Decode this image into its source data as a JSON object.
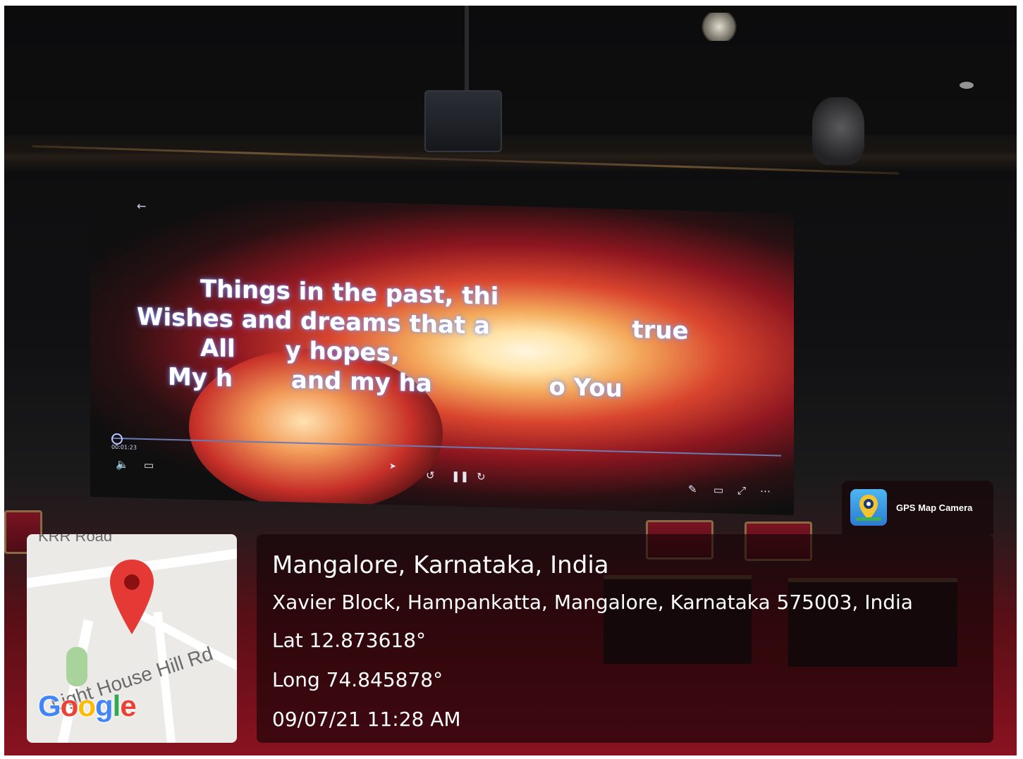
{
  "video": {
    "lyrics": [
      "Things in the past, thi",
      "Wishes and dreams that a                 true",
      "All      y hopes,",
      "My h       and my ha              o You"
    ],
    "elapsed_time": "00:01:23",
    "back_icon": "back-arrow-icon",
    "controls": [
      "volume-icon",
      "captions-icon",
      "cursor-icon",
      "rewind-icon",
      "pause-icon",
      "forward-icon",
      "pen-icon",
      "aspect-ratio-icon",
      "fullscreen-icon",
      "more-icon"
    ]
  },
  "map": {
    "top_road_label": "KRR Road",
    "bottom_road_label": "Light House Hill Rd",
    "google_logo": "Google",
    "pin_icon": "map-pin-icon"
  },
  "badge": {
    "app_name": "GPS Map Camera",
    "icon": "gps-map-camera-icon"
  },
  "info": {
    "title": "Mangalore, Karnataka, India",
    "address": "Xavier Block, Hampankatta, Mangalore, Karnataka 575003, India",
    "latitude": "Lat 12.873618°",
    "longitude": "Long 74.845878°",
    "datetime": "09/07/21 11:28 AM"
  },
  "colors": {
    "panel_bg": "#14040699",
    "stage_red": "#8a1220",
    "lyric_glow": "#8fa0ff",
    "pin_red": "#e53935"
  }
}
